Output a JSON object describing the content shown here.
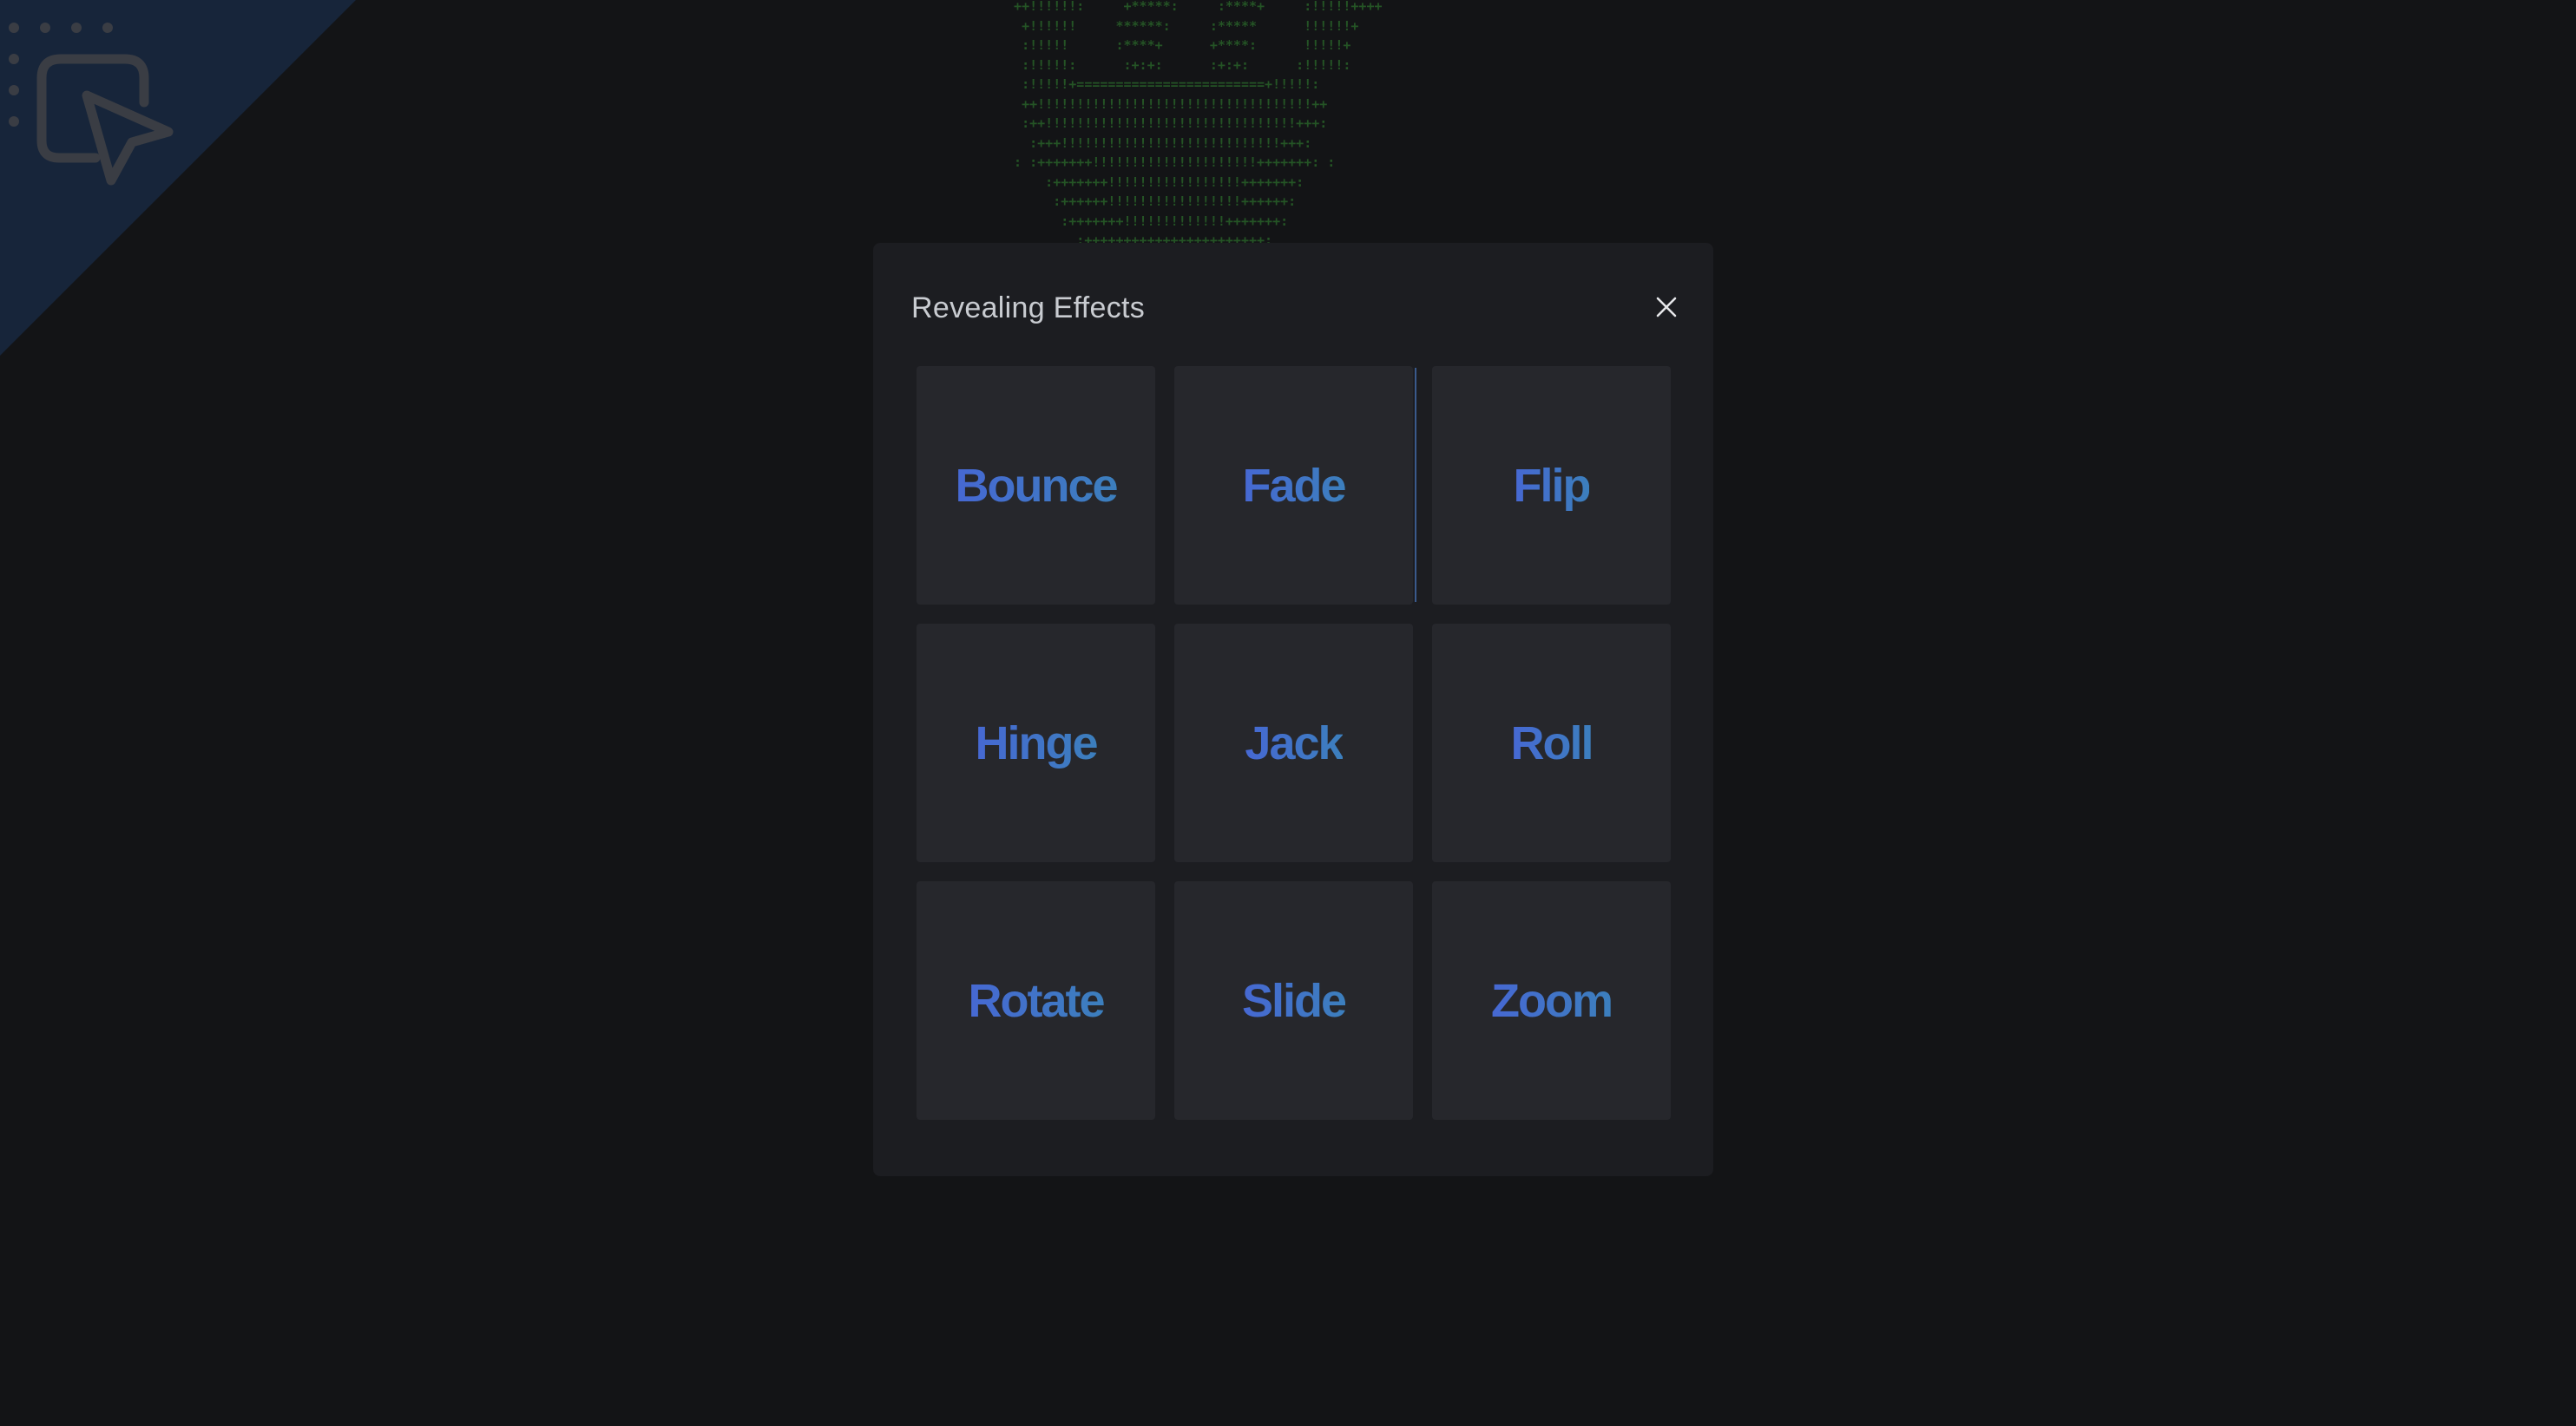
{
  "background": {
    "page_color": "#131416",
    "corner_badge_color": "#17253a",
    "corner_icon": "pointer-select-icon",
    "ascii_art_color": "#2a6a2a"
  },
  "modal": {
    "title": "Revealing Effects",
    "close_icon": "close-icon",
    "effects": [
      {
        "label": "Bounce"
      },
      {
        "label": "Fade"
      },
      {
        "label": "Flip"
      },
      {
        "label": "Hinge"
      },
      {
        "label": "Jack"
      },
      {
        "label": "Roll"
      },
      {
        "label": "Rotate"
      },
      {
        "label": "Slide"
      },
      {
        "label": "Zoom"
      }
    ],
    "tile_color": "#26272c",
    "label_gradient": [
      "#4668d3",
      "#3c7fbd"
    ]
  }
}
